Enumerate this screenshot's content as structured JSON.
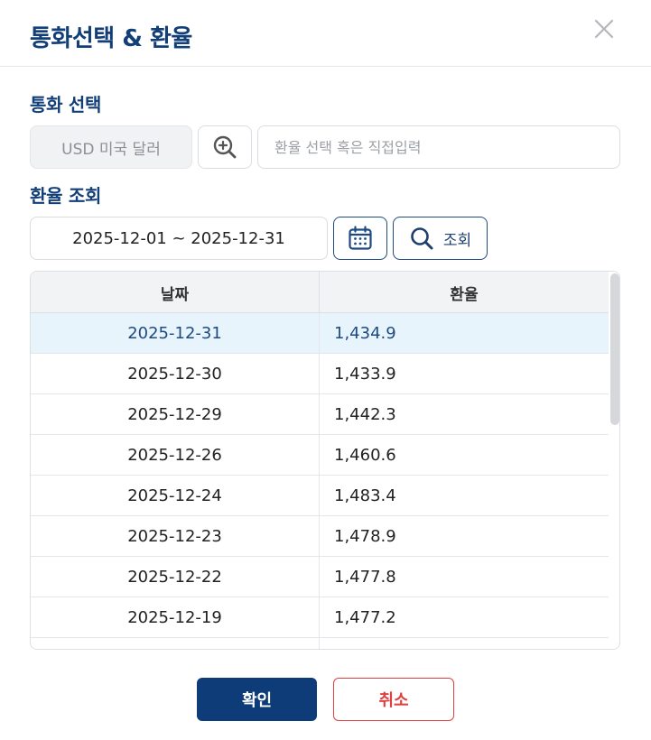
{
  "dialog": {
    "title": "통화선택 & 환율"
  },
  "currency_section": {
    "label": "통화 선택",
    "selected_currency": "USD 미국 달러",
    "rate_input_placeholder": "환율 선택 혹은 직접입력",
    "rate_input_value": ""
  },
  "rate_section": {
    "label": "환율 조회",
    "date_range": "2025-12-01 ~ 2025-12-31",
    "lookup_label": "조회"
  },
  "table": {
    "headers": [
      "날짜",
      "환율"
    ],
    "rows": [
      {
        "date": "2025-12-31",
        "rate": "1,434.9",
        "selected": true
      },
      {
        "date": "2025-12-30",
        "rate": "1,433.9"
      },
      {
        "date": "2025-12-29",
        "rate": "1,442.3"
      },
      {
        "date": "2025-12-26",
        "rate": "1,460.6"
      },
      {
        "date": "2025-12-24",
        "rate": "1,483.4"
      },
      {
        "date": "2025-12-23",
        "rate": "1,478.9"
      },
      {
        "date": "2025-12-22",
        "rate": "1,477.8"
      },
      {
        "date": "2025-12-19",
        "rate": "1,477.2"
      },
      {
        "date": "",
        "rate": ""
      }
    ]
  },
  "footer": {
    "confirm_label": "확인",
    "cancel_label": "취소"
  },
  "colors": {
    "brand": "#0d3c78",
    "title": "#123f78",
    "cancel": "#e0413f",
    "selected_row": "#e8f4fc"
  },
  "icons": {
    "close": "close-icon",
    "currency_search": "zoom-in-icon",
    "calendar": "calendar-icon",
    "lookup": "search-icon"
  }
}
